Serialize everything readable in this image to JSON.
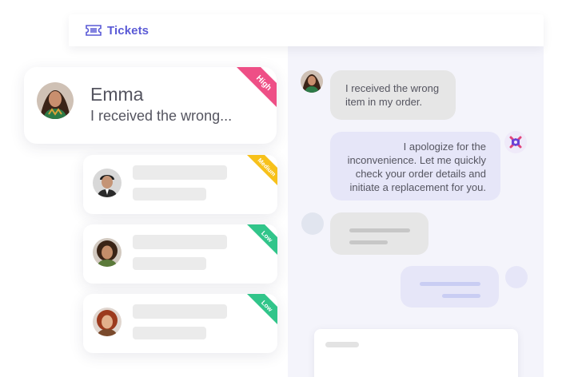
{
  "header": {
    "title": "Tickets",
    "icon": "ticket-icon",
    "accent": "#5a5ad6"
  },
  "tickets": [
    {
      "name": "Emma",
      "preview": "I received the wrong...",
      "priority": "High",
      "color": "#ee4f86",
      "avatar": "woman-avatar"
    },
    {
      "priority": "Medium",
      "color": "#f7c11b",
      "avatar": "man-avatar"
    },
    {
      "priority": "Low",
      "color": "#31c58a",
      "avatar": "woman-curly-avatar"
    },
    {
      "priority": "Low",
      "color": "#31c58a",
      "avatar": "woman-red-hair-avatar"
    }
  ],
  "chat": {
    "messages": [
      {
        "from": "customer",
        "text": "I received the wrong item in my order."
      },
      {
        "from": "agent",
        "text": "I apologize for the inconvenience. Let me quickly check your order details and initiate a replacement for you.",
        "avatar": "bot-logo-icon"
      }
    ]
  },
  "colors": {
    "panel_bg": "#f4f4fb",
    "bubble_in": "#e6e6e6",
    "bubble_out": "#e6e6f8",
    "skeleton": "#ebebeb"
  }
}
